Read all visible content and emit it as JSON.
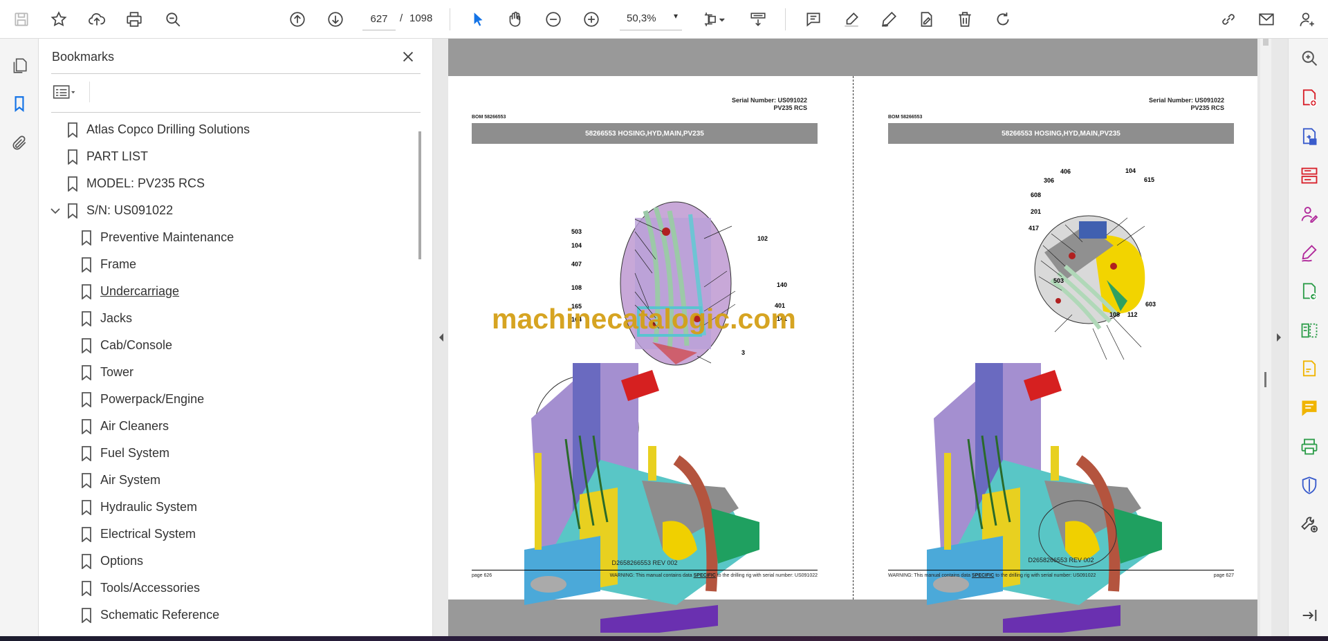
{
  "toolbar": {
    "current_page": "627",
    "page_separator": "/",
    "total_pages": "1098",
    "zoom": "50,3%"
  },
  "bookmarks": {
    "title": "Bookmarks",
    "items": [
      {
        "label": "Atlas Copco Drilling Solutions",
        "level": 0
      },
      {
        "label": "PART LIST",
        "level": 0
      },
      {
        "label": "MODEL: PV235 RCS",
        "level": 0
      },
      {
        "label": "S/N: US091022",
        "level": 0,
        "expanded": true
      },
      {
        "label": "Preventive Maintenance",
        "level": 1
      },
      {
        "label": "Frame",
        "level": 1
      },
      {
        "label": "Undercarriage",
        "level": 1,
        "hovered": true
      },
      {
        "label": "Jacks",
        "level": 1
      },
      {
        "label": "Cab/Console",
        "level": 1
      },
      {
        "label": "Tower",
        "level": 1
      },
      {
        "label": "Powerpack/Engine",
        "level": 1
      },
      {
        "label": "Air Cleaners",
        "level": 1
      },
      {
        "label": "Fuel System",
        "level": 1
      },
      {
        "label": "Air System",
        "level": 1
      },
      {
        "label": "Hydraulic System",
        "level": 1
      },
      {
        "label": "Electrical System",
        "level": 1
      },
      {
        "label": "Options",
        "level": 1
      },
      {
        "label": "Tools/Accessories",
        "level": 1
      },
      {
        "label": "Schematic Reference",
        "level": 1
      }
    ]
  },
  "left_page": {
    "serial_line1": "Serial Number: US091022",
    "serial_line2": "PV235 RCS",
    "bom": "BOM 58266553",
    "band_title": "58266553 HOSING,HYD,MAIN,PV235",
    "drawing_no": "D2658266553 REV 002",
    "page_label": "page 626",
    "warning_pre": "WARNING:  This manual contains data ",
    "warning_bold": "SPECIFIC",
    "warning_post": " to the drilling rig with serial number: US091022",
    "callouts": [
      "503",
      "104",
      "407",
      "108",
      "165",
      "164",
      "102",
      "140",
      "401",
      "141",
      "3"
    ]
  },
  "right_page": {
    "serial_line1": "Serial Number: US091022",
    "serial_line2": "PV235 RCS",
    "bom": "BOM 58266553",
    "band_title": "58266553 HOSING,HYD,MAIN,PV235",
    "drawing_no": "D2658266553 REV 002",
    "page_label": "page 627",
    "warning_pre": "WARNING:  This manual contains data ",
    "warning_bold": "SPECIFIC",
    "warning_post": " to the drilling rig with serial number: US091022",
    "callouts": [
      "406",
      "306",
      "608",
      "201",
      "417",
      "104",
      "615",
      "503",
      "108",
      "112",
      "603"
    ]
  },
  "watermark": "machinecatalogic.com",
  "colors": {
    "accent_blue": "#1473e6",
    "band_grey": "#8e8e8e",
    "watermark_gold": "#d4a017",
    "tool_magenta": "#b0289a",
    "tool_green": "#2d9d4a",
    "tool_yellow": "#f0b400",
    "tool_blue": "#3a5ccc"
  }
}
